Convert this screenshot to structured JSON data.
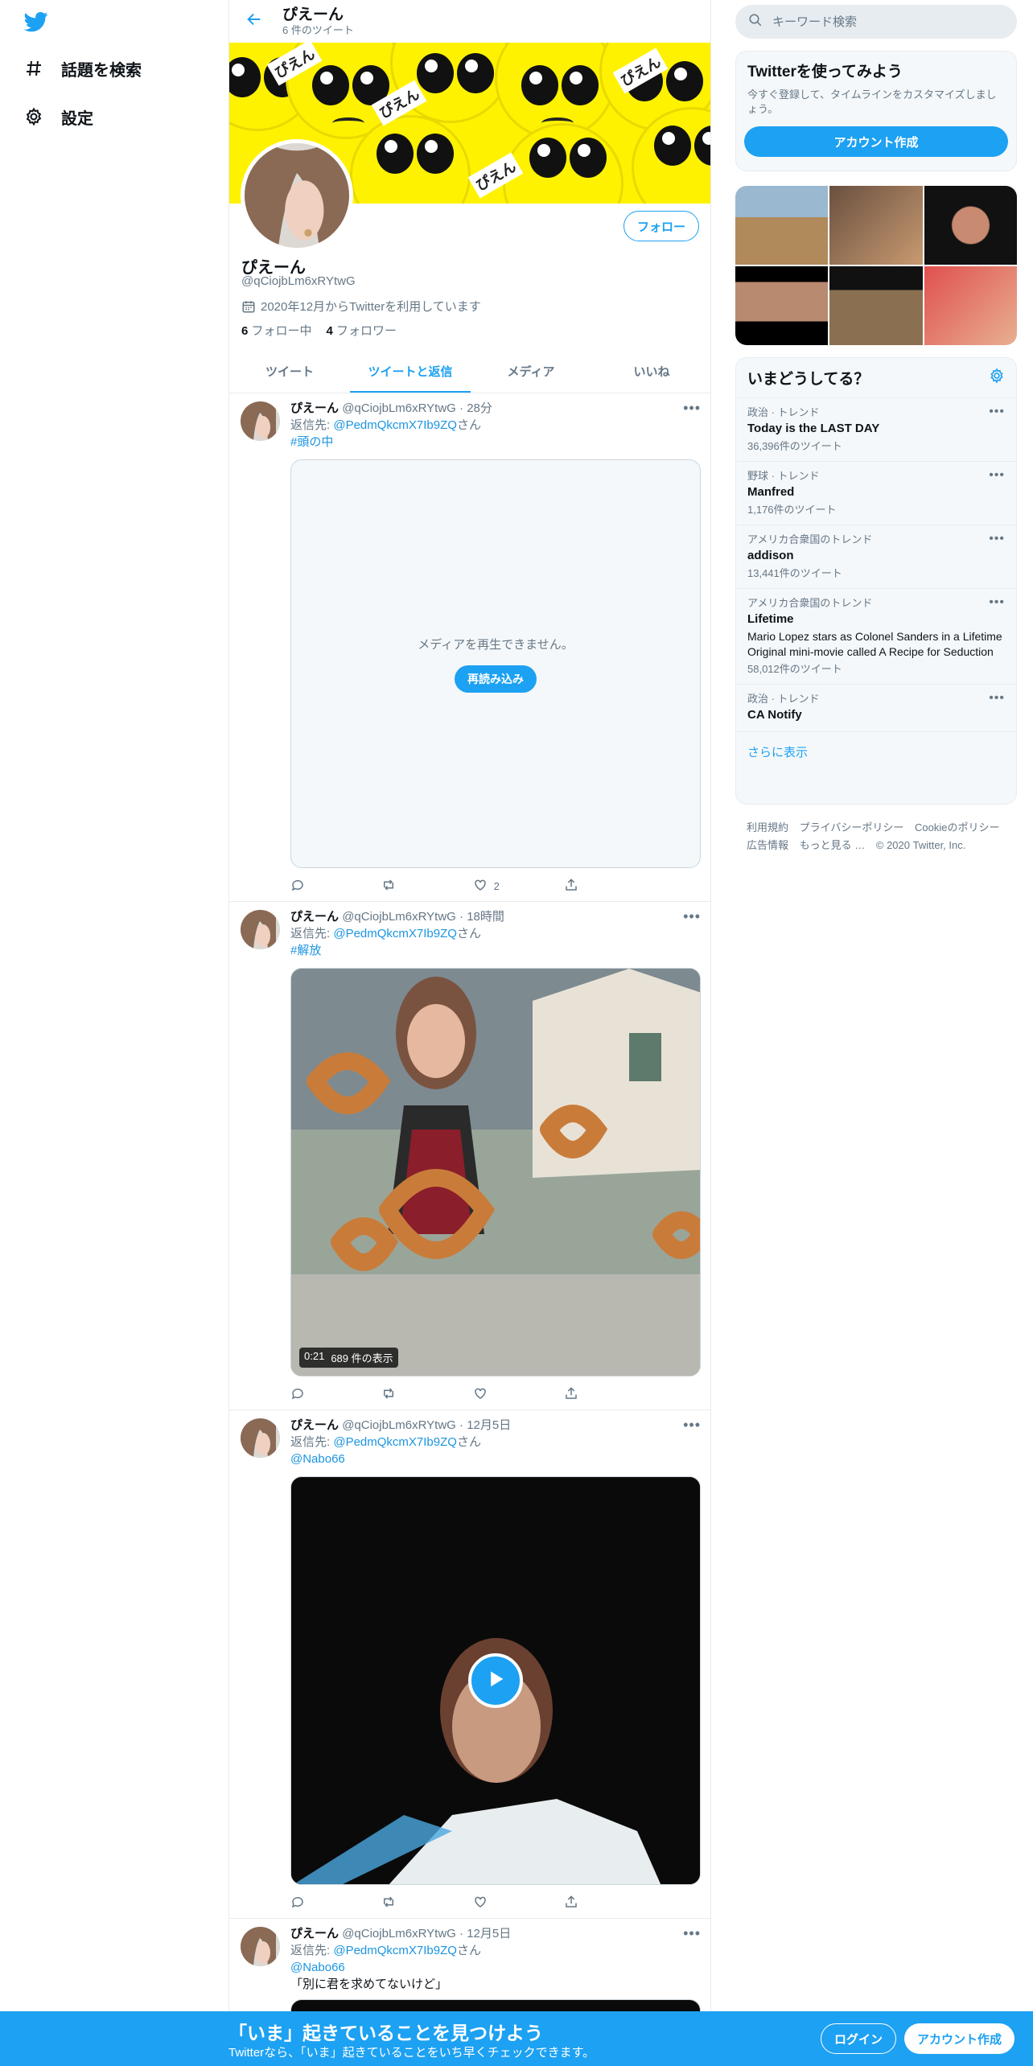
{
  "colors": {
    "accent": "#1da1f2",
    "link": "#1b95e0",
    "muted": "#657786",
    "banner": "#fff200"
  },
  "nav": {
    "logo_icon": "twitter-bird-icon",
    "items": [
      {
        "label": "話題を検索",
        "icon": "hashtag-icon"
      },
      {
        "label": "設定",
        "icon": "gear-icon"
      }
    ]
  },
  "header": {
    "name": "ぴえーん",
    "tweet_count": "6 件のツイート"
  },
  "banner": {
    "words": [
      "ぴえん",
      "ぴえん",
      "ぴえん",
      "ぴえん"
    ]
  },
  "profile": {
    "follow_button": "フォロー",
    "name": "ぴえーん",
    "handle": "@qCiojbLm6xRYtwG",
    "joined": "2020年12月からTwitterを利用しています",
    "following_count": "6",
    "following_label": "フォロー中",
    "followers_count": "4",
    "followers_label": "フォロワー"
  },
  "tabs": [
    "ツイート",
    "ツイートと返信",
    "メディア",
    "いいね"
  ],
  "tweets": [
    {
      "name": "ぴえーん",
      "handle": "@qCiojbLm6xRYtwG",
      "time": "· 28分",
      "reply_prefix": "返信先: ",
      "reply_to": "@PedmQkcmX7Ib9ZQ",
      "reply_suffix": "さん",
      "text": "#頭の中",
      "error": "メディアを再生できません。",
      "reload": "再読み込み",
      "likes": "2"
    },
    {
      "name": "ぴえーん",
      "handle": "@qCiojbLm6xRYtwG",
      "time": "· 18時間",
      "reply_prefix": "返信先: ",
      "reply_to": "@PedmQkcmX7Ib9ZQ",
      "reply_suffix": "さん",
      "text": "#解放",
      "duration": "0:21",
      "views": "689 件の表示"
    },
    {
      "name": "ぴえーん",
      "handle": "@qCiojbLm6xRYtwG",
      "time": "· 12月5日",
      "reply_prefix": "返信先: ",
      "reply_to": "@PedmQkcmX7Ib9ZQ",
      "reply_suffix": "さん",
      "text": "@Nabo66"
    },
    {
      "name": "ぴえーん",
      "handle": "@qCiojbLm6xRYtwG",
      "time": "· 12月5日",
      "reply_prefix": "返信先: ",
      "reply_to": "@PedmQkcmX7Ib9ZQ",
      "reply_suffix": "さん",
      "text": "@Nabo66",
      "text2": "「別に君を求めてないけど」"
    }
  ],
  "right": {
    "search_placeholder": "キーワード検索",
    "signup": {
      "title": "Twitterを使ってみよう",
      "subtitle": "今すぐ登録して、タイムラインをカスタマイズしましょう。",
      "button": "アカウント作成"
    },
    "trends_title": "いまどうしてる？",
    "trends": [
      {
        "context": "政治 · トレンド",
        "name": "Today is the LAST DAY",
        "desc": "",
        "count": "36,396件のツイート"
      },
      {
        "context": "野球 · トレンド",
        "name": "Manfred",
        "desc": "",
        "count": "1,176件のツイート"
      },
      {
        "context": "アメリカ合衆国のトレンド",
        "name": "addison",
        "desc": "",
        "count": "13,441件のツイート"
      },
      {
        "context": "アメリカ合衆国のトレンド",
        "name": "Lifetime",
        "desc": "Mario Lopez stars as Colonel Sanders in a Lifetime Original mini-movie called A Recipe for Seduction",
        "count": "58,012件のツイート"
      },
      {
        "context": "政治 · トレンド",
        "name": "CA Notify",
        "desc": "",
        "count": ""
      }
    ],
    "show_more": "さらに表示",
    "footer": [
      "利用規約",
      "プライバシーポリシー",
      "Cookieのポリシー",
      "広告情報",
      "もっと見る …",
      "© 2020 Twitter, Inc."
    ]
  },
  "bottom_bar": {
    "title": "「いま」起きていることを見つけよう",
    "subtitle": "Twitterなら、「いま」起きていることをいち早くチェックできます。",
    "login": "ログイン",
    "signup": "アカウント作成"
  }
}
